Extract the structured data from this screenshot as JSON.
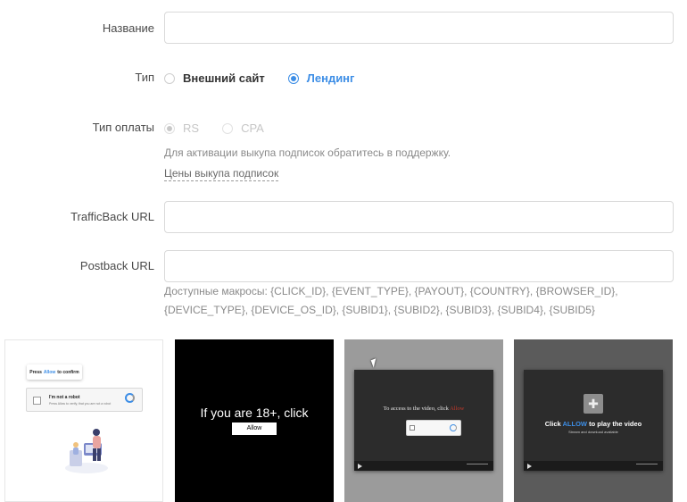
{
  "form": {
    "name_label": "Название",
    "type_label": "Тип",
    "type_options": [
      {
        "label": "Внешний сайт",
        "checked": false
      },
      {
        "label": "Лендинг",
        "checked": true
      }
    ],
    "payment_label": "Тип оплаты",
    "payment_options": [
      {
        "label": "RS",
        "checked": true,
        "disabled": true
      },
      {
        "label": "CPA",
        "checked": false,
        "disabled": true
      }
    ],
    "payment_hint": "Для активации выкупа подписок обратитесь в поддержку.",
    "payment_link": "Цены выкупа подписок",
    "trafficback_label": "TrafficBack URL",
    "postback_label": "Postback URL",
    "macros_hint": "Доступные макросы: {CLICK_ID}, {EVENT_TYPE}, {PAYOUT}, {COUNTRY}, {BROWSER_ID}, {DEVICE_TYPE}, {DEVICE_OS_ID}, {SUBID1}, {SUBID2}, {SUBID3}, {SUBID4}, {SUBID5}"
  },
  "templates": {
    "t1": {
      "pill_pre": "Press",
      "pill_allow": "Allow",
      "pill_post": "to confirm",
      "captcha_title": "I'm not a robot",
      "captcha_sub": "Press Allow to verify, that you are not a robot"
    },
    "t2": {
      "message": "If you are 18+, click",
      "button": "Allow"
    },
    "t3": {
      "message_pre": "To access to the video, click",
      "message_highlight": "Allow"
    },
    "t4": {
      "message_pre": "Click",
      "message_highlight": "ALLOW",
      "message_post": "to play the video",
      "sub": "Stream and download available"
    }
  },
  "colors": {
    "accent": "#3d8ee6",
    "label": "#4a4a4a",
    "hint": "#8a8a8a"
  }
}
